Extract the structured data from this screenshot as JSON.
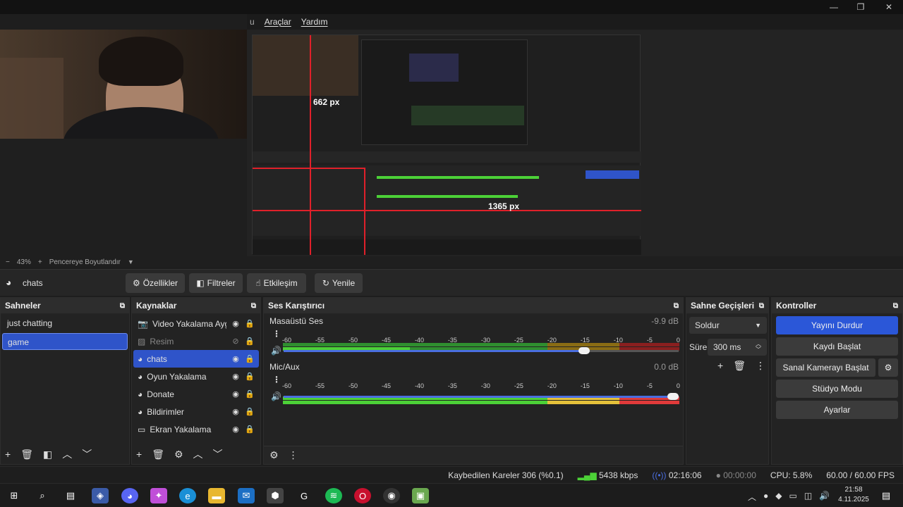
{
  "menu": [
    "Araçlar",
    "Yardım"
  ],
  "window_controls": [
    "—",
    "❐",
    "✕"
  ],
  "preview": {
    "measure_vertical": "662 px",
    "measure_horizontal": "1365 px"
  },
  "zoom": {
    "minus": "−",
    "value": "43%",
    "plus": "+",
    "fit_label": "Pencereye Boyutlandır"
  },
  "source_toolbar": {
    "current_source": "chats",
    "buttons": [
      "Özellikler",
      "Filtreler",
      "Etkileşim",
      "Yenile"
    ]
  },
  "scenes": {
    "title": "Sahneler",
    "items": [
      "just chatting",
      "game"
    ],
    "selected": "game"
  },
  "sources": {
    "title": "Kaynaklar",
    "items": [
      {
        "name": "Video Yakalama Aygıt",
        "icon": "camera-icon"
      },
      {
        "name": "Resim",
        "icon": "image-icon"
      },
      {
        "name": "chats",
        "icon": "browser-icon"
      },
      {
        "name": "Oyun Yakalama",
        "icon": "gamepad-icon"
      },
      {
        "name": "Donate",
        "icon": "browser-icon"
      },
      {
        "name": "Bildirimler",
        "icon": "browser-icon"
      },
      {
        "name": "Ekran Yakalama",
        "icon": "monitor-icon"
      }
    ]
  },
  "mixer": {
    "title": "Ses Karıştırıcı",
    "channels": [
      {
        "name": "Masaüstü Ses",
        "db": "-9.9 dB",
        "volume": 0.76
      },
      {
        "name": "Mic/Aux",
        "db": "0.0 dB",
        "volume": 1.0
      }
    ],
    "ticks": [
      "-60",
      "-55",
      "-50",
      "-45",
      "-40",
      "-35",
      "-30",
      "-25",
      "-20",
      "-15",
      "-10",
      "-5",
      "0"
    ]
  },
  "transitions": {
    "title": "Sahne Geçişleri",
    "type": "Soldur",
    "duration_label": "Süre",
    "duration_value": "300 ms"
  },
  "controls": {
    "title": "Kontroller",
    "buttons": [
      "Yayını Durdur",
      "Kaydı Başlat",
      "Sanal Kamerayı Başlat",
      "Stüdyo Modu",
      "Ayarlar"
    ]
  },
  "status": {
    "dropped": "Kaybedilen Kareler 306 (%0.1)",
    "bitrate": "5438 kbps",
    "stream_time": "02:16:06",
    "rec_time": "00:00:00",
    "cpu": "CPU: 5.8%",
    "fps": "60.00 / 60.00 FPS"
  },
  "taskbar": {
    "time": "21:58",
    "date": "4.11.2025"
  },
  "colors": {
    "accent": "#2f54c9",
    "live": "#2b57d8",
    "meter_green": "#4cd137",
    "meter_yellow": "#e5c13a",
    "meter_red": "#e03a3a"
  }
}
